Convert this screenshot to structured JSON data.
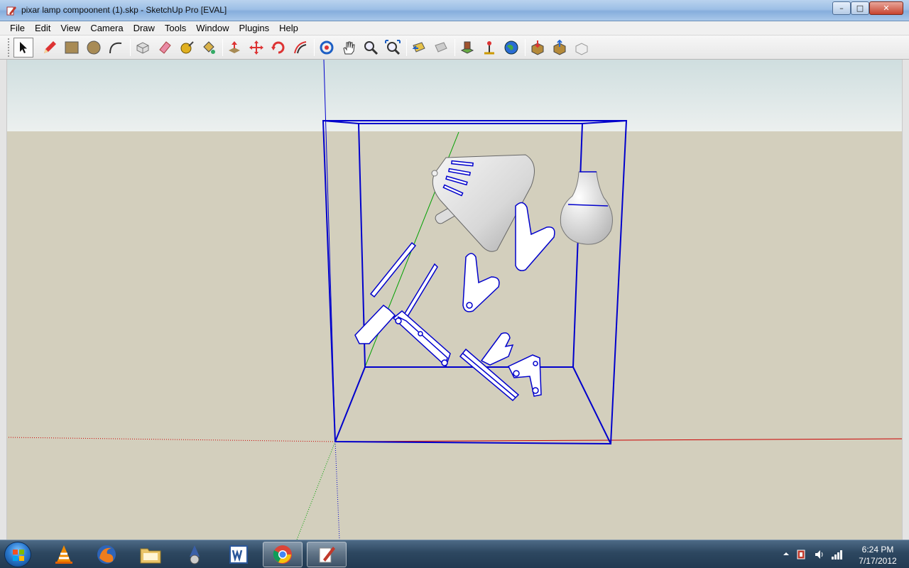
{
  "window": {
    "title": "pixar lamp compoonent (1).skp - SketchUp Pro [EVAL]",
    "controls": {
      "minimize": "–",
      "maximize": "□",
      "close": "✕"
    }
  },
  "menubar": {
    "items": [
      "File",
      "Edit",
      "View",
      "Camera",
      "Draw",
      "Tools",
      "Window",
      "Plugins",
      "Help"
    ]
  },
  "toolbar": {
    "tools": [
      {
        "name": "select-tool",
        "icon": "arrow-cursor-icon",
        "active": true
      },
      {
        "name": "pencil-tool",
        "icon": "pencil-icon"
      },
      {
        "name": "rectangle-tool",
        "icon": "rectangle-icon"
      },
      {
        "name": "circle-tool",
        "icon": "circle-icon"
      },
      {
        "name": "arc-tool",
        "icon": "arc-icon"
      },
      {
        "name": "make-component-tool",
        "icon": "component-icon"
      },
      {
        "name": "eraser-tool",
        "icon": "eraser-icon"
      },
      {
        "name": "tape-measure-tool",
        "icon": "tape-measure-icon"
      },
      {
        "name": "paint-bucket-tool",
        "icon": "paint-bucket-icon"
      },
      {
        "name": "push-pull-tool",
        "icon": "push-pull-icon"
      },
      {
        "name": "move-tool",
        "icon": "move-icon"
      },
      {
        "name": "rotate-tool",
        "icon": "rotate-icon"
      },
      {
        "name": "offset-tool",
        "icon": "offset-icon"
      },
      {
        "name": "orbit-tool",
        "icon": "orbit-icon"
      },
      {
        "name": "pan-tool",
        "icon": "hand-icon"
      },
      {
        "name": "zoom-tool",
        "icon": "magnifier-icon"
      },
      {
        "name": "zoom-extents-tool",
        "icon": "zoom-extents-icon"
      },
      {
        "name": "previous-view-tool",
        "icon": "previous-view-icon"
      },
      {
        "name": "next-view-tool",
        "icon": "next-view-icon"
      },
      {
        "name": "add-location-tool",
        "icon": "location-icon"
      },
      {
        "name": "terrain-tool",
        "icon": "terrain-icon"
      },
      {
        "name": "google-earth-tool",
        "icon": "earth-icon"
      },
      {
        "name": "get-models-tool",
        "icon": "get-models-icon"
      },
      {
        "name": "share-model-tool",
        "icon": "share-model-icon"
      },
      {
        "name": "share-component-tool",
        "icon": "share-component-icon"
      }
    ]
  },
  "viewport": {
    "sky_color": "#e6ecec",
    "ground_color": "#d3cfbd",
    "selection_color": "#0000cc",
    "axis_colors": {
      "red": "#cc0000",
      "green": "#00a000",
      "blue": "#0000cc"
    }
  },
  "taskbar": {
    "apps": [
      {
        "name": "vlc",
        "icon": "vlc-cone-icon"
      },
      {
        "name": "firefox",
        "icon": "firefox-icon"
      },
      {
        "name": "explorer",
        "icon": "folder-icon"
      },
      {
        "name": "app-wizard",
        "icon": "wizard-icon"
      },
      {
        "name": "word",
        "icon": "word-icon"
      },
      {
        "name": "chrome",
        "icon": "chrome-icon",
        "open": true
      },
      {
        "name": "sketchup",
        "icon": "sketchup-icon",
        "open": true
      }
    ],
    "clock": {
      "time": "6:24 PM",
      "date": "7/17/2012"
    }
  }
}
